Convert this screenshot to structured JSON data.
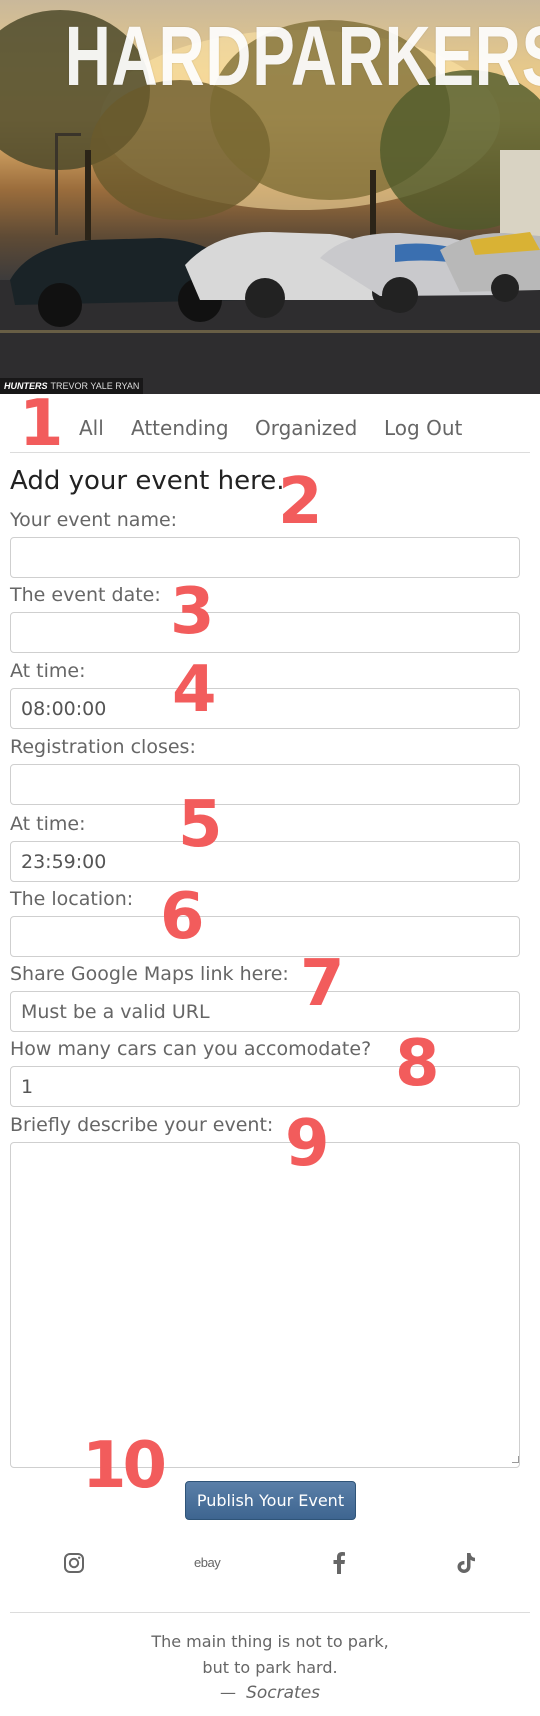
{
  "hero": {
    "title": "HARDPARKERS",
    "credit_brand": "HUNTERS",
    "credit_name": "TREVOR YALE RYAN"
  },
  "nav": {
    "items": [
      "All",
      "Attending",
      "Organized",
      "Log Out"
    ]
  },
  "form": {
    "heading": "Add your event here.",
    "event_name": {
      "label": "Your event name:",
      "value": ""
    },
    "event_date": {
      "label": "The event date:",
      "value": ""
    },
    "event_time": {
      "label": "At time:",
      "value": "08:00:00"
    },
    "reg_close_date": {
      "label": "Registration closes:",
      "value": ""
    },
    "reg_close_time": {
      "label": "At time:",
      "value": "23:59:00"
    },
    "location": {
      "label": "The location:",
      "value": ""
    },
    "maps_link": {
      "label": "Share Google Maps link here:",
      "placeholder": "Must be a valid URL"
    },
    "cars": {
      "label": "How many cars can you accomodate?",
      "value": "1"
    },
    "description": {
      "label": "Briefly describe your event:",
      "value": ""
    },
    "submit_label": "Publish Your Event"
  },
  "annotations": [
    "1",
    "2",
    "3",
    "4",
    "5",
    "6",
    "7",
    "8",
    "9",
    "10"
  ],
  "footer": {
    "social": [
      "instagram-icon",
      "ebay-icon",
      "facebook-icon",
      "tiktok-icon"
    ],
    "ebay_text": "ebay",
    "quote_line1": "The main thing is not to park,",
    "quote_line2": "but to park hard.",
    "quote_dash": "—",
    "quote_author": "Socrates"
  },
  "colors": {
    "annotation": "#f25c5c",
    "button": "#44698f",
    "text": "#666666"
  }
}
